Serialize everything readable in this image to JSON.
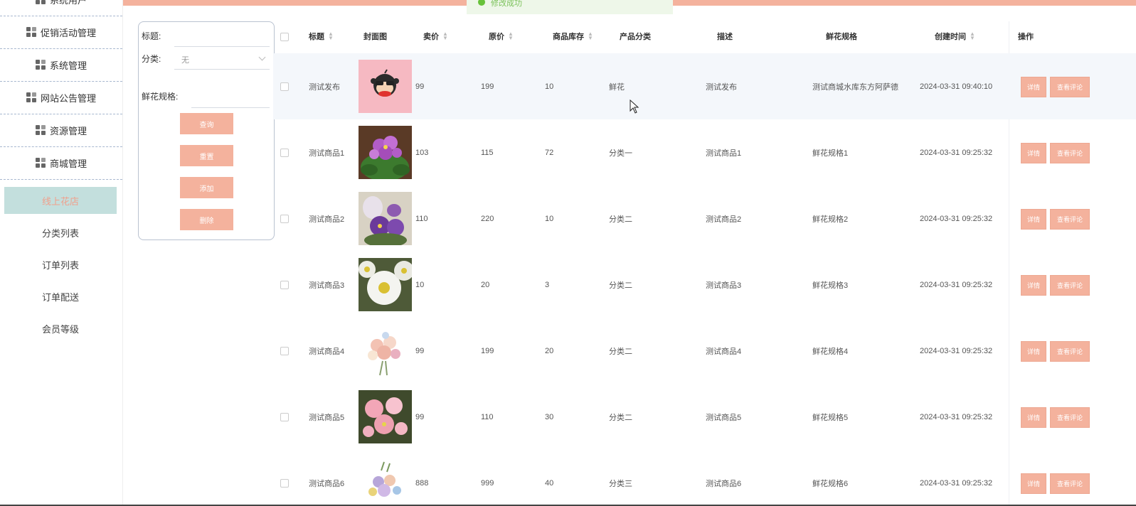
{
  "toast": {
    "text": "修改成功"
  },
  "sidebar": {
    "items": [
      {
        "label": "系统用户"
      },
      {
        "label": "促销活动管理"
      },
      {
        "label": "系统管理"
      },
      {
        "label": "网站公告管理"
      },
      {
        "label": "资源管理"
      },
      {
        "label": "商城管理"
      }
    ],
    "subitems": [
      {
        "label": "线上花店",
        "active": true
      },
      {
        "label": "分类列表"
      },
      {
        "label": "订单列表"
      },
      {
        "label": "订单配送"
      },
      {
        "label": "会员等级"
      }
    ]
  },
  "filter": {
    "title_label": "标题:",
    "category_label": "分类:",
    "category_value": "无",
    "spec_label": "鲜花规格:",
    "buttons": {
      "search": "查询",
      "reset": "重置",
      "add": "添加",
      "delete": "删除"
    }
  },
  "table": {
    "headers": {
      "title": "标题",
      "cover": "封面图",
      "price": "卖价",
      "orig": "原价",
      "stock": "商品库存",
      "category": "产品分类",
      "desc": "描述",
      "spec": "鲜花规格",
      "created": "创建时间",
      "ops": "操作"
    },
    "actions": {
      "detail": "详情",
      "comments": "查看评论"
    },
    "rows": [
      {
        "title": "测试发布",
        "cover": "cartoon-monkey",
        "price": "99",
        "orig": "199",
        "stock": "10",
        "category": "鲜花",
        "desc": "测试发布",
        "spec": "测试商城水库东方阿萨德",
        "created": "2024-03-31 09:40:10"
      },
      {
        "title": "测试商品1",
        "cover": "purple-violets",
        "price": "103",
        "orig": "115",
        "stock": "72",
        "category": "分类一",
        "desc": "测试商品1",
        "spec": "鲜花规格1",
        "created": "2024-03-31 09:25:32"
      },
      {
        "title": "测试商品2",
        "cover": "violet-flowers",
        "price": "110",
        "orig": "220",
        "stock": "10",
        "category": "分类二",
        "desc": "测试商品2",
        "spec": "鲜花规格2",
        "created": "2024-03-31 09:25:32"
      },
      {
        "title": "测试商品3",
        "cover": "white-daisies",
        "price": "10",
        "orig": "20",
        "stock": "3",
        "category": "分类二",
        "desc": "测试商品3",
        "spec": "鲜花规格3",
        "created": "2024-03-31 09:25:32"
      },
      {
        "title": "测试商品4",
        "cover": "pastel-bouquet",
        "price": "99",
        "orig": "199",
        "stock": "20",
        "category": "分类二",
        "desc": "测试商品4",
        "spec": "鲜花规格4",
        "created": "2024-03-31 09:25:32"
      },
      {
        "title": "测试商品5",
        "cover": "pink-flowers",
        "price": "99",
        "orig": "110",
        "stock": "30",
        "category": "分类二",
        "desc": "测试商品5",
        "spec": "鲜花规格5",
        "created": "2024-03-31 09:25:32"
      },
      {
        "title": "测试商品6",
        "cover": "mixed-bouquet",
        "price": "888",
        "orig": "999",
        "stock": "40",
        "category": "分类三",
        "desc": "测试商品6",
        "spec": "鲜花规格6",
        "created": "2024-03-31 09:25:32"
      }
    ]
  }
}
